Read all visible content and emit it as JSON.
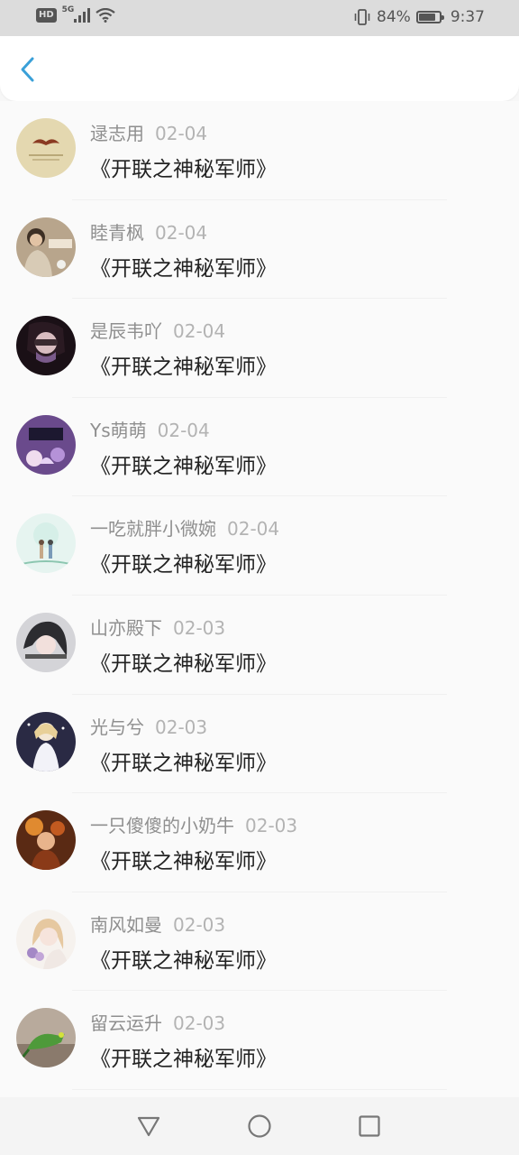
{
  "status_bar": {
    "hd": "HD",
    "network": "5G",
    "battery_percent": "84%",
    "battery_level": 0.84,
    "time": "9:37"
  },
  "header": {
    "back_icon": "chevron-left-icon",
    "accent_color": "#3aa0d8"
  },
  "comments": [
    {
      "user": "逯志用",
      "date": "02-04",
      "text": "《开联之神秘军师》",
      "avatar_icon": "mustache-avatar"
    },
    {
      "user": "睦青枫",
      "date": "02-04",
      "text": "《开联之神秘军师》",
      "avatar_icon": "person-photo-avatar"
    },
    {
      "user": "是辰韦吖",
      "date": "02-04",
      "text": "《开联之神秘军师》",
      "avatar_icon": "masked-person-avatar"
    },
    {
      "user": "Ys萌萌",
      "date": "02-04",
      "text": "《开联之神秘军师》",
      "avatar_icon": "anime-avatar"
    },
    {
      "user": "一吃就胖小微婉",
      "date": "02-04",
      "text": "《开联之神秘军师》",
      "avatar_icon": "couple-illustration-avatar"
    },
    {
      "user": "山亦殿下",
      "date": "02-03",
      "text": "《开联之神秘军师》",
      "avatar_icon": "girl-photo-avatar"
    },
    {
      "user": "光与兮",
      "date": "02-03",
      "text": "《开联之神秘军师》",
      "avatar_icon": "angel-illustration-avatar"
    },
    {
      "user": "一只傻傻的小奶牛",
      "date": "02-03",
      "text": "《开联之神秘军师》",
      "avatar_icon": "fantasy-girl-avatar"
    },
    {
      "user": "南风如曼",
      "date": "02-03",
      "text": "《开联之神秘军师》",
      "avatar_icon": "flower-girl-avatar"
    },
    {
      "user": "留云运升",
      "date": "02-03",
      "text": "《开联之神秘军师》",
      "avatar_icon": "bird-avatar"
    }
  ],
  "nav_bar": {
    "back": "triangle-back-icon",
    "home": "circle-home-icon",
    "recents": "square-recents-icon"
  }
}
